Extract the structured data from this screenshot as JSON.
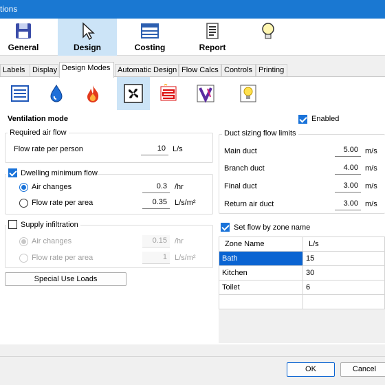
{
  "window": {
    "title": "tions"
  },
  "ribbon": [
    {
      "key": "general",
      "label": "General",
      "icon": "floppy-disk-icon"
    },
    {
      "key": "design",
      "label": "Design",
      "icon": "cursor-arrow-icon"
    },
    {
      "key": "costing",
      "label": "Costing",
      "icon": "table-list-icon"
    },
    {
      "key": "report",
      "label": "Report",
      "icon": "document-lines-icon"
    },
    {
      "key": "extra",
      "label": "",
      "icon": "lightbulb-icon"
    }
  ],
  "tabs": [
    "Labels",
    "Display",
    "Design Modes",
    "Automatic Design",
    "Flow Calcs",
    "Controls",
    "Printing"
  ],
  "active_tab": "Design Modes",
  "mode_icons": [
    "ducts-icon",
    "water-drop-icon",
    "flame-icon",
    "fan-icon",
    "heater-coil-icon",
    "valve-icon",
    "lightbulb-icon"
  ],
  "selected_mode": "fan-icon",
  "ventilation": {
    "heading": "Ventilation mode",
    "enabled_label": "Enabled",
    "enabled": true
  },
  "required_air_flow": {
    "title": "Required air flow",
    "flow_per_person_label": "Flow rate per person",
    "flow_per_person_value": "10",
    "flow_per_person_unit": "L/s"
  },
  "dwelling_min_flow": {
    "title": "Dwelling minimum flow",
    "checked": true,
    "air_changes_label": "Air changes",
    "air_changes_value": "0.3",
    "air_changes_unit": "/hr",
    "flow_area_label": "Flow rate per area",
    "flow_area_value": "0.35",
    "flow_area_unit": "L/s/m²",
    "selected": "air_changes"
  },
  "supply_infiltration": {
    "title": "Supply infiltration",
    "checked": false,
    "air_changes_label": "Air changes",
    "air_changes_value": "0.15",
    "air_changes_unit": "/hr",
    "flow_area_label": "Flow rate per area",
    "flow_area_value": "1",
    "flow_area_unit": "L/s/m²"
  },
  "special_use_loads_label": "Special Use Loads",
  "duct_sizing": {
    "title": "Duct sizing flow limits",
    "rows": [
      {
        "label": "Main duct",
        "value": "5.00",
        "unit": "m/s"
      },
      {
        "label": "Branch duct",
        "value": "4.00",
        "unit": "m/s"
      },
      {
        "label": "Final duct",
        "value": "3.00",
        "unit": "m/s"
      },
      {
        "label": "Return air duct",
        "value": "3.00",
        "unit": "m/s"
      }
    ]
  },
  "zone_flow": {
    "checkbox_label": "Set flow by zone name",
    "checked": true,
    "columns": [
      "Zone Name",
      "L/s"
    ],
    "rows": [
      {
        "zone": "Bath",
        "flow": "15"
      },
      {
        "zone": "Kitchen",
        "flow": "30"
      },
      {
        "zone": "Toilet",
        "flow": "6"
      },
      {
        "zone": "",
        "flow": ""
      }
    ]
  },
  "buttons": {
    "ok": "OK",
    "cancel": "Cancel"
  },
  "colors": {
    "titlebar": "#1a78d2",
    "accent": "#1a73d9",
    "selection": "#0a64d2",
    "active_ribbon": "#cce4f7"
  }
}
